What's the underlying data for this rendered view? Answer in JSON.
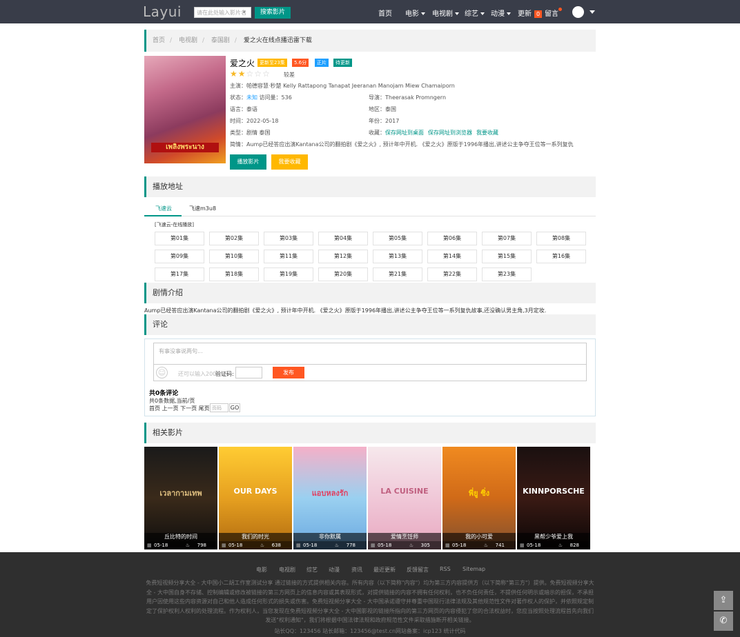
{
  "header": {
    "logo": "Layui",
    "search_placeholder": "请在此处输入影片名",
    "search_button": "搜索影片",
    "nav": [
      "首页",
      "电影",
      "电视剧",
      "综艺",
      "动漫",
      "更新",
      "留言"
    ],
    "update_badge": "0"
  },
  "breadcrumb": [
    "首页",
    "电视剧",
    "泰国剧",
    "爱之火在线点播迅雷下载"
  ],
  "movie": {
    "title": "爱之火",
    "tags": [
      "更新至23集",
      "5.6分",
      "正片",
      "待更新"
    ],
    "rating_stars": 2,
    "rating_max": 5,
    "rating_text": "较差",
    "cast_label": "主演：",
    "cast": "帕德容慧·秒楚  Kelly  Rattapong  Tanapat  Jeeranan  Manojam  Miew  Chamaiporn",
    "status_label": "状态：",
    "status_value": "未知",
    "visits_label": "访问量：",
    "visits": "536",
    "director_label": "导演：",
    "director": "Theerasak  Promngern",
    "language_label": "语言：",
    "language": "泰语",
    "region_label": "地区：",
    "region": "泰国",
    "time_label": "时间：",
    "time": "2022-05-18",
    "year_label": "年份：",
    "year": "2017",
    "type_label": "类型：",
    "type": "剧情  泰国",
    "collect_label": "收藏：",
    "collect_links": [
      "保存网址到桌面",
      "保存网址到浏览器",
      "我要收藏"
    ],
    "synopsis_label": "简情：",
    "synopsis": "Aump已经答应出演Kantana公司的翻拍剧《爱之火》, 预计年中开机. 《爱之火》原版于1996年播出,讲述公主争夺王位等一系列复仇",
    "poster_title": "เพลิงพระนาง",
    "play_button": "播放影片",
    "collect_button": "我要收藏"
  },
  "play": {
    "section_title": "播放地址",
    "tabs": [
      "飞速云",
      "飞速m3u8"
    ],
    "source_label": "[飞速云-在线播放]",
    "episodes": [
      "第01集",
      "第02集",
      "第03集",
      "第04集",
      "第05集",
      "第06集",
      "第07集",
      "第08集",
      "第09集",
      "第10集",
      "第11集",
      "第12集",
      "第13集",
      "第14集",
      "第15集",
      "第16集",
      "第17集",
      "第18集",
      "第19集",
      "第20集",
      "第21集",
      "第22集",
      "第23集"
    ]
  },
  "plot": {
    "section_title": "剧情介绍",
    "text": "Aump已经答应出演Kantana公司的翻拍剧《爱之火》, 预计年中开机. 《爱之火》原版于1996年播出,讲述公主争夺王位等一系列复仇故事,还没确认男主角,3月定妆."
  },
  "comments": {
    "section_title": "评论",
    "placeholder": "有事没事说两句...",
    "limit_text": "还可以输入200",
    "vcode_label": "验证码:",
    "publish": "发布",
    "count_title": "共0条评论",
    "count_info": "共0条数据,当前/页",
    "pager": "首页 上一页 下一页 尾页",
    "page_placeholder": "页码",
    "go": "GO"
  },
  "related": {
    "section_title": "相关影片",
    "items": [
      {
        "title": "丘比特的时间",
        "date": "05-18",
        "views": "798",
        "poster_text": "เวลากามเทพ"
      },
      {
        "title": "我们的时光",
        "date": "05-18",
        "views": "638",
        "poster_text": "OUR DAYS"
      },
      {
        "title": "非你默属",
        "date": "05-18",
        "views": "778",
        "poster_text": "แอบหลงรัก"
      },
      {
        "title": "爱情烹饪师",
        "date": "05-18",
        "views": "305",
        "poster_text": "LA CUISINE"
      },
      {
        "title": "我的小可爱",
        "date": "05-18",
        "views": "741",
        "poster_text": "พี่ยู ซิ่ง"
      },
      {
        "title": "黑帮少爷爱上我",
        "date": "05-18",
        "views": "828",
        "poster_text": "KINNPORSCHE"
      }
    ]
  },
  "footer": {
    "links": [
      "电影",
      "电视剧",
      "综艺",
      "动漫",
      "资讯",
      "最近更新",
      "反馈留言",
      "RSS",
      "Sitemap"
    ],
    "disclaimer": "免费短视频分享大全 - 大中国小二胡工作室测试分享 通过链接的方式提供相关内容。所有内容（以下简称\"内容\"）均为第三方内容提供方（以下简称\"第三方\"）提供。免费短视频分享大全 - 大中国自身不存储、控制编辑或修改被链接的第三方网页上的信息内容或其表现形式，对提供链接的内容不拥有任何权利，也不负任何责任，不提供任何明示或暗示的担保，不承担用户因使用这些内容资源对自己和他人造成任何形式的损失或伤害。免费短视频分享大全 - 大中国承诺遵守并尊重中国现行法律法规及其他规范性文件对著作权人的保护，并依照规定制定了保护权利人权利的处理流程。作为权利人，当您发现在免费短视频分享大全 - 大中国影视的链接所指向的第三方网页的内容侵犯了您的合法权益时，您应当按照处理流程首先向我们发送\"权利通知\"，我们将根据中国法律法规和政府规范性文件采取措施断开相关链接。",
    "contact": "站长QQ：123456 站长邮箱：123456@test.cn网站备案：icp123 统计代码"
  },
  "colors": {
    "accent": "#009688",
    "orange": "#ff5722",
    "yellow": "#ffb800",
    "blue": "#1e9fff",
    "green": "#009688",
    "dark": "#393d49"
  }
}
